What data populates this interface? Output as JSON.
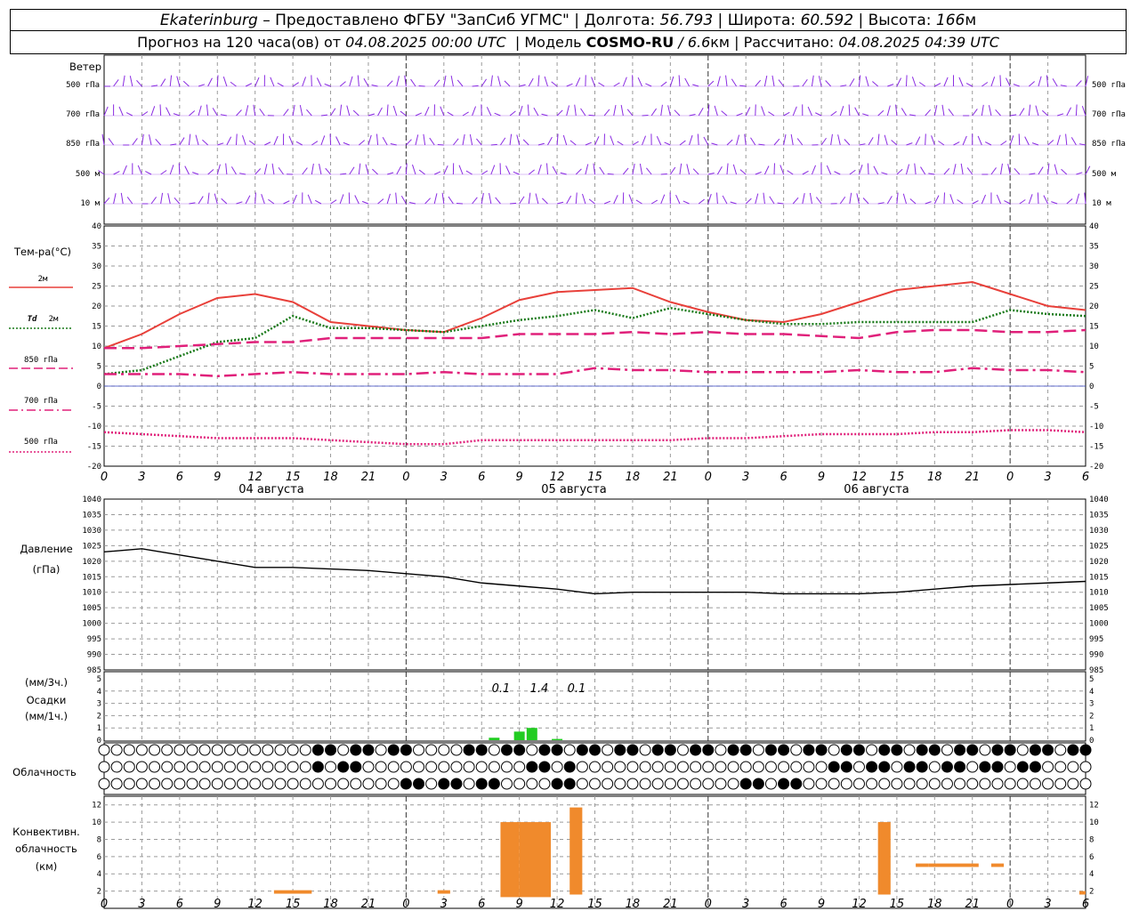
{
  "header": {
    "city": "Ekaterinburg",
    "provider": " – Предоставлено ФГБУ \"ЗапСиб УГМС\" | Долгота: ",
    "lon": "56.793",
    "lat_label": " | Широта: ",
    "lat": "60.592",
    "alt_label": " | Высота: ",
    "alt": "166",
    "alt_unit": "м",
    "forecast_label": "Прогноз на 120 часа(ов) от ",
    "forecast_time": "04.08.2025 00:00 UTC",
    "model_label": "  | Модель ",
    "model_name": "COSMO-RU",
    "model_res": " / 6.6",
    "model_res_unit": "км",
    "calc_label": " | Рассчитано: ",
    "calc_time": "04.08.2025 04:39 UTC"
  },
  "wind_panel": {
    "title": "Ветер",
    "levels": [
      "500 гПа",
      "700 гПа",
      "850 гПа",
      "500 м",
      "10  м"
    ],
    "barb_color": "#8a2be2"
  },
  "temp_panel": {
    "title": "Тем-ра(°C)",
    "legend": [
      {
        "label": "2м",
        "color": "#e8403a",
        "style": "solid"
      },
      {
        "label_a": "Td",
        "label_b": "2м",
        "color": "#1a7a1a",
        "style": "dotted"
      },
      {
        "label": "850 гПа",
        "color": "#e0207a",
        "style": "dashed"
      },
      {
        "label": "700 гПа",
        "color": "#e0207a",
        "style": "dashdot"
      },
      {
        "label": "500 гПа",
        "color": "#e0207a",
        "style": "dotted"
      }
    ]
  },
  "pressure_panel": {
    "title": "Давление",
    "unit": "(гПа)"
  },
  "precip_panel": {
    "unit3": "(мм/3ч.)",
    "title": "Осадки",
    "unit1": "(мм/1ч.)",
    "labels": [
      "0.1",
      "1.4",
      "0.1"
    ],
    "bar_color": "#22cc22"
  },
  "cloud_panel": {
    "title": "Облачность"
  },
  "conv_panel": {
    "title_a": "Конвективн.",
    "title_b": "облачность",
    "unit": "(км)",
    "bar_color": "#f08a2c"
  },
  "day_labels": [
    "04 августа",
    "05 августа",
    "06 августа"
  ],
  "hour_ticks": [
    "0",
    "3",
    "6",
    "9",
    "12",
    "15",
    "18",
    "21",
    "0",
    "3",
    "6",
    "9",
    "12",
    "15",
    "18",
    "21",
    "0",
    "3",
    "6",
    "9",
    "12",
    "15",
    "18",
    "21",
    "0",
    "3",
    "6"
  ],
  "chart_data": [
    {
      "type": "line",
      "name": "temperature",
      "x_hours": [
        0,
        3,
        6,
        9,
        12,
        15,
        18,
        21,
        24,
        27,
        30,
        33,
        36,
        39,
        42,
        45,
        48,
        51,
        54,
        57,
        60,
        63,
        66,
        69,
        72,
        75,
        78
      ],
      "ylim": [
        -20,
        40
      ],
      "yticks": [
        40,
        35,
        30,
        25,
        20,
        15,
        10,
        5,
        0,
        -5,
        -10,
        -15,
        -20
      ],
      "series": [
        {
          "name": "2м",
          "values": [
            9.5,
            13,
            18,
            22,
            23,
            21,
            16,
            15,
            14,
            13.5,
            17,
            21.5,
            23.5,
            24,
            24.5,
            21,
            18.5,
            16.5,
            16,
            18,
            21,
            24,
            25,
            26,
            23,
            20,
            19
          ]
        },
        {
          "name": "Td 2м",
          "values": [
            3,
            4,
            7.5,
            11,
            12,
            17.5,
            14.5,
            14.5,
            14,
            13.5,
            15,
            16.5,
            17.5,
            19,
            17,
            19.5,
            18,
            16.5,
            15.5,
            15.5,
            16,
            16,
            16,
            16,
            19,
            18,
            17.5
          ]
        },
        {
          "name": "850 гПа",
          "values": [
            9.5,
            9.5,
            10,
            10.5,
            11,
            11,
            12,
            12,
            12,
            12,
            12,
            13,
            13,
            13,
            13.5,
            13,
            13.5,
            13,
            13,
            12.5,
            12,
            13.5,
            14,
            14,
            13.5,
            13.5,
            14
          ]
        },
        {
          "name": "700 гПа",
          "values": [
            3,
            3,
            3,
            2.5,
            3,
            3.5,
            3,
            3,
            3,
            3.5,
            3,
            3,
            3,
            4.5,
            4,
            4,
            3.5,
            3.5,
            3.5,
            3.5,
            4,
            3.5,
            3.5,
            4.5,
            4,
            4,
            3.5
          ]
        },
        {
          "name": "500 гПа",
          "values": [
            -11.5,
            -12,
            -12.5,
            -13,
            -13,
            -13,
            -13.5,
            -14,
            -14.5,
            -14.5,
            -13.5,
            -13.5,
            -13.5,
            -13.5,
            -13.5,
            -13.5,
            -13,
            -13,
            -12.5,
            -12,
            -12,
            -12,
            -11.5,
            -11.5,
            -11,
            -11,
            -11.5
          ]
        }
      ]
    },
    {
      "type": "line",
      "name": "pressure",
      "x_hours": [
        0,
        3,
        6,
        9,
        12,
        15,
        18,
        21,
        24,
        27,
        30,
        33,
        36,
        39,
        42,
        45,
        48,
        51,
        54,
        57,
        60,
        63,
        66,
        69,
        72,
        75,
        78
      ],
      "ylim": [
        985,
        1040
      ],
      "yticks": [
        1040,
        1035,
        1030,
        1025,
        1020,
        1015,
        1010,
        1005,
        1000,
        995,
        990,
        985
      ],
      "series": [
        {
          "name": "давление",
          "values": [
            1023,
            1024,
            1022,
            1020,
            1018,
            1018,
            1017.5,
            1017,
            1016,
            1015,
            1013,
            1012,
            1011,
            1009.5,
            1010,
            1010,
            1010,
            1010,
            1009.5,
            1009.5,
            1009.5,
            1010,
            1011,
            1012,
            1012.5,
            1013,
            1013.5
          ]
        }
      ]
    },
    {
      "type": "bar",
      "name": "precipitation",
      "ylim": [
        0,
        5
      ],
      "yticks": [
        5,
        4,
        3,
        2,
        1,
        0
      ],
      "x_hours": [
        31,
        33,
        34,
        36
      ],
      "values": [
        0.2,
        0.7,
        1.0,
        0.1
      ]
    },
    {
      "type": "bar",
      "name": "convective clouds",
      "ylim": [
        0,
        13
      ],
      "yticks": [
        12,
        10,
        8,
        6,
        4,
        2
      ],
      "bars": [
        {
          "start_h": 13.5,
          "end_h": 16.5,
          "bottom_km": 1.7,
          "top_km": 2.1
        },
        {
          "start_h": 26.5,
          "end_h": 27.5,
          "bottom_km": 1.7,
          "top_km": 2.1
        },
        {
          "start_h": 31.5,
          "end_h": 33,
          "bottom_km": 1.3,
          "top_km": 10
        },
        {
          "start_h": 33,
          "end_h": 35.5,
          "bottom_km": 1.3,
          "top_km": 10
        },
        {
          "start_h": 37,
          "end_h": 38,
          "bottom_km": 1.6,
          "top_km": 11.7
        },
        {
          "start_h": 61.5,
          "end_h": 62.5,
          "bottom_km": 1.6,
          "top_km": 10
        },
        {
          "start_h": 64.5,
          "end_h": 65.5,
          "bottom_km": 4.8,
          "top_km": 5.2
        },
        {
          "start_h": 65.5,
          "end_h": 69.5,
          "bottom_km": 4.8,
          "top_km": 5.2
        },
        {
          "start_h": 70.5,
          "end_h": 71.5,
          "bottom_km": 4.8,
          "top_km": 5.2
        },
        {
          "start_h": 77.5,
          "end_h": 78,
          "bottom_km": 1.6,
          "top_km": 2
        }
      ]
    }
  ]
}
